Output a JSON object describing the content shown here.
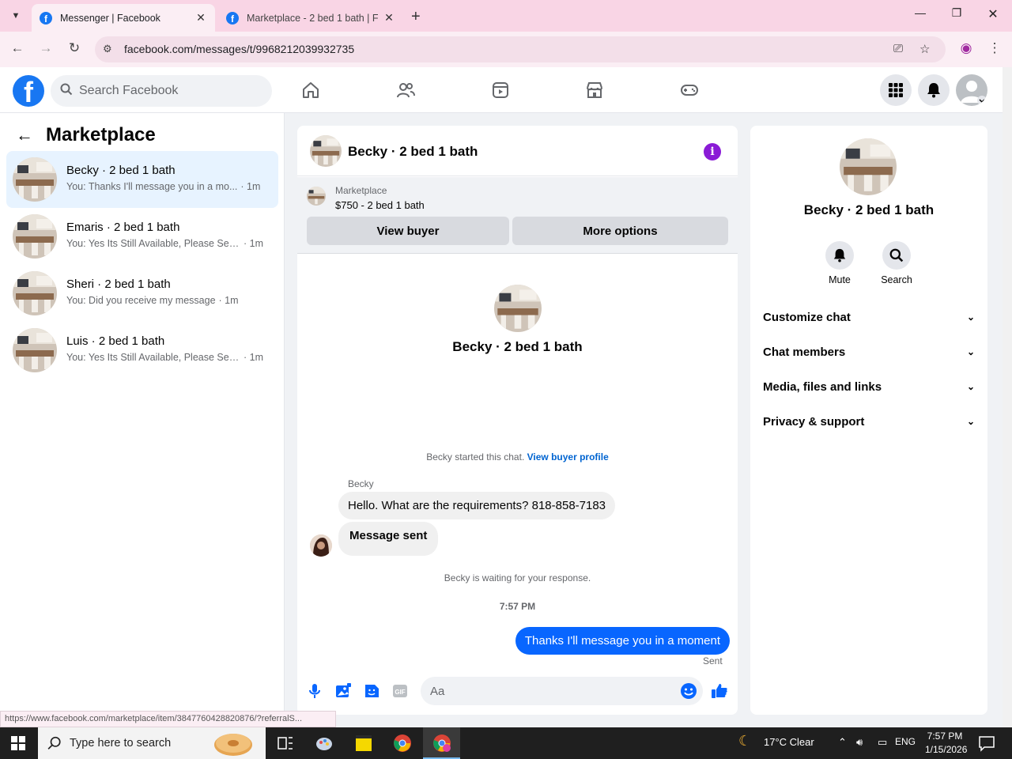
{
  "browser": {
    "tabs": [
      {
        "title": "Messenger | Facebook",
        "active": true
      },
      {
        "title": "Marketplace - 2 bed 1 bath | Fa",
        "active": false
      }
    ],
    "url": "facebook.com/messages/t/9968212039932735",
    "status_url": "https://www.facebook.com/marketplace/item/3847760428820876/?referralS..."
  },
  "facebook": {
    "logo_letter": "f",
    "search_placeholder": "Search Facebook"
  },
  "sidebar": {
    "title": "Marketplace",
    "conversations": [
      {
        "name": "Becky · 2 bed 1 bath",
        "preview": "You: Thanks I'll message you in a mo...",
        "time": "· 1m",
        "active": true
      },
      {
        "name": "Emaris · 2 bed 1 bath",
        "preview": "You: Yes Its Still Available, Please Sen...",
        "time": "· 1m",
        "active": false
      },
      {
        "name": "Sheri · 2 bed 1 bath",
        "preview": "You: Did you receive my message",
        "time": "· 1m",
        "active": false
      },
      {
        "name": "Luis · 2 bed 1 bath",
        "preview": "You: Yes Its Still Available, Please Sen...",
        "time": "· 1m",
        "active": false
      }
    ]
  },
  "chat": {
    "header_name": "Becky · 2 bed 1 bath",
    "listing_category": "Marketplace",
    "listing_price": "$750 - 2 bed 1 bath",
    "view_buyer_label": "View buyer",
    "more_options_label": "More options",
    "profile_name": "Becky · 2 bed 1 bath",
    "started_text": "Becky started this chat.",
    "view_buyer_profile": "View buyer profile",
    "sender_label": "Becky",
    "incoming": [
      "Hello. What are the requirements? 818-858-7183",
      "Message sent"
    ],
    "waiting_text": "Becky is waiting for your response.",
    "timestamp": "7:57 PM",
    "outgoing": "Thanks I'll message you in a moment",
    "sent_label": "Sent",
    "composer_placeholder": "Aa"
  },
  "info_panel": {
    "name": "Becky · 2 bed 1 bath",
    "mute_label": "Mute",
    "search_label": "Search",
    "sections": [
      "Customize chat",
      "Chat members",
      "Media, files and links",
      "Privacy & support"
    ]
  },
  "taskbar": {
    "search_placeholder": "Type here to search",
    "weather": "17°C  Clear",
    "language": "ENG",
    "time": "7:57 PM",
    "date": "1/15/2026"
  }
}
